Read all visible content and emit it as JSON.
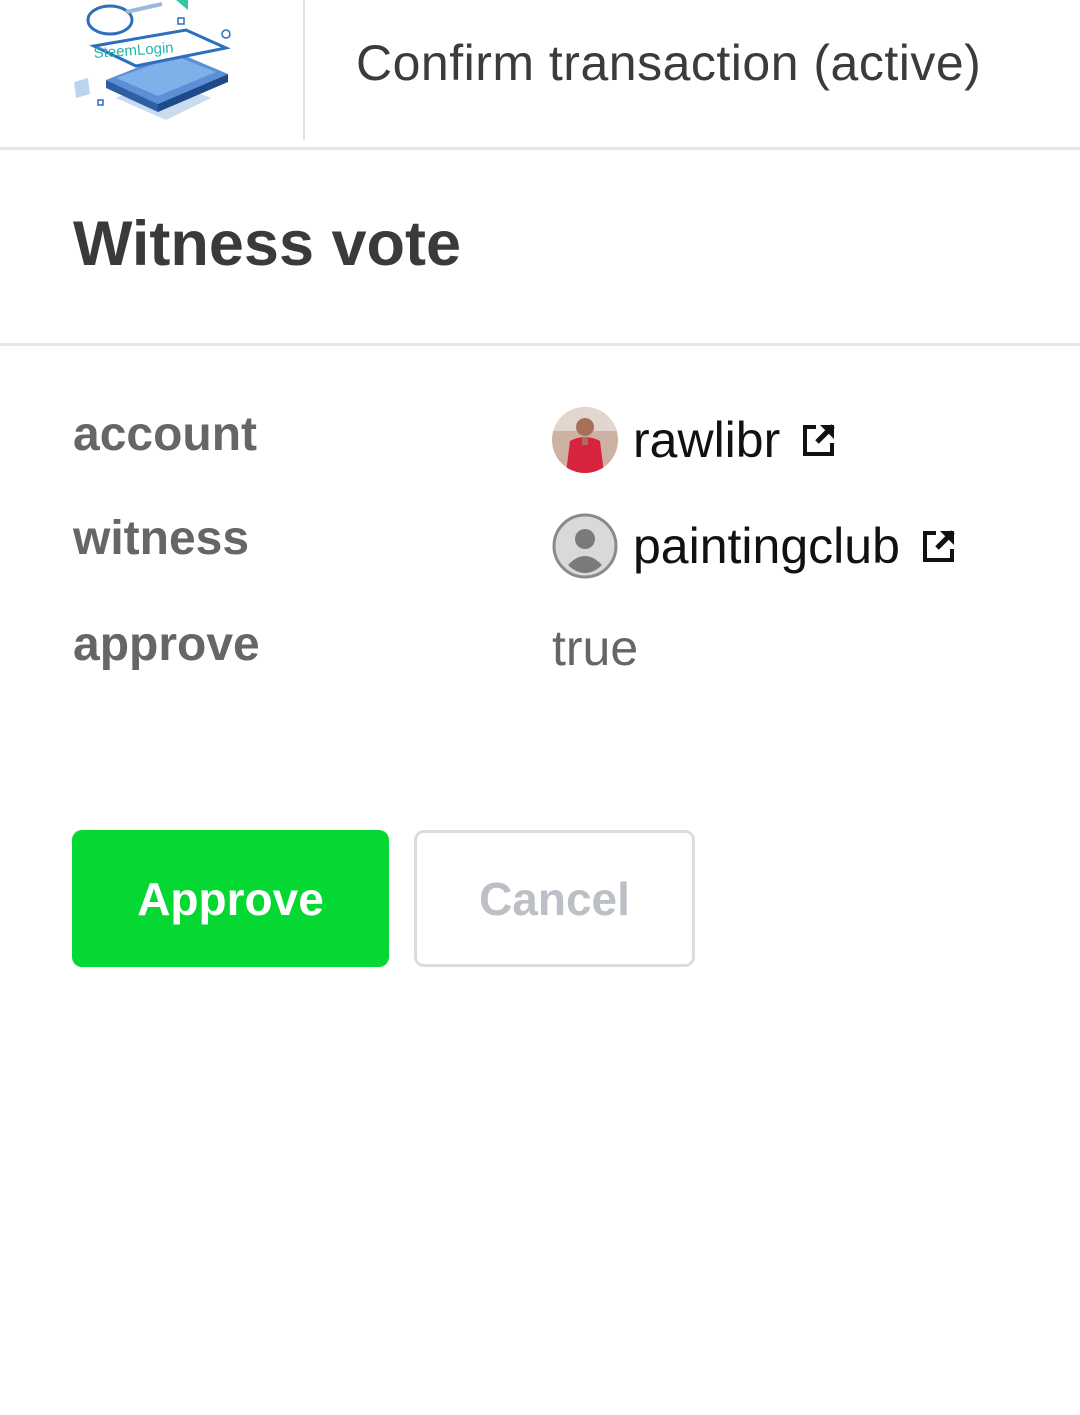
{
  "header": {
    "logo_text": "SteemLogin",
    "title": "Confirm transaction (active)"
  },
  "operation": {
    "title": "Witness vote"
  },
  "fields": [
    {
      "label": "account",
      "value": "rawlibr",
      "icon": "external-link-icon"
    },
    {
      "label": "witness",
      "value": "paintingclub",
      "icon": "external-link-icon"
    },
    {
      "label": "approve",
      "value": "true"
    }
  ],
  "buttons": {
    "approve_label": "Approve",
    "cancel_label": "Cancel"
  },
  "colors": {
    "approve": "#06d833",
    "brand": "#2c6fbe"
  }
}
